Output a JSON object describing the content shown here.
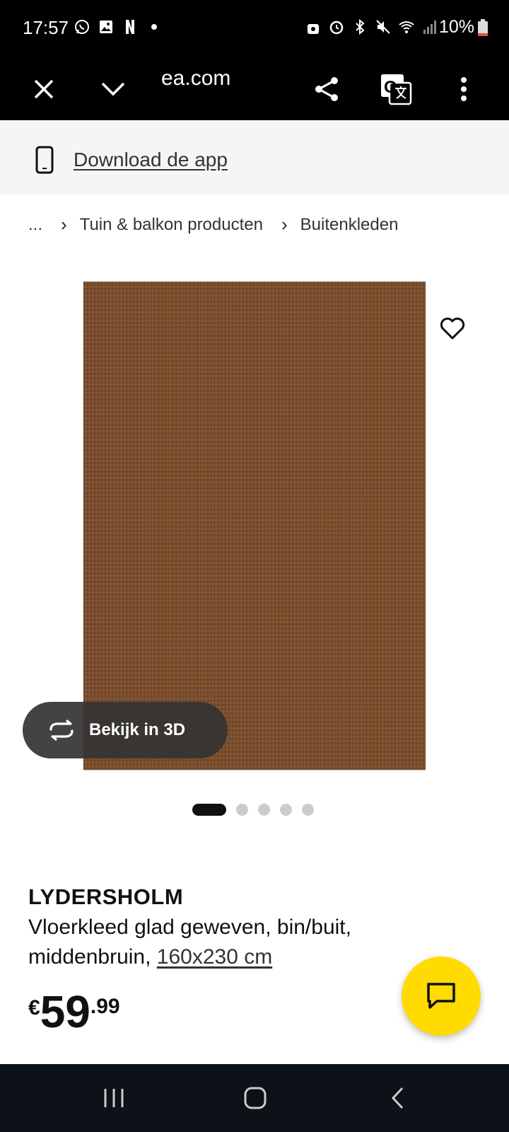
{
  "status_bar": {
    "time": "17:57",
    "battery": "10%",
    "left_icons": [
      "whatsapp-icon",
      "gallery-icon",
      "netflix-icon",
      "dot-icon"
    ],
    "right_icons": [
      "lock-icon",
      "alarm-icon",
      "bluetooth-icon",
      "mute-icon",
      "wifi-icon",
      "signal-icon"
    ]
  },
  "browser": {
    "url": "ea.com",
    "buttons": [
      "close-icon",
      "chevron-down-icon",
      "share-icon",
      "translate-icon",
      "more-icon"
    ]
  },
  "banner": {
    "link_label": "Download de app",
    "icon": "phone-icon"
  },
  "breadcrumb": {
    "ellipsis": "...",
    "items": [
      "Tuin & balkon producten",
      "Buitenkleden"
    ]
  },
  "gallery": {
    "view3d_label": "Bekijk in 3D",
    "image_count": 5,
    "active_index": 0
  },
  "product": {
    "name": "LYDERSHOLM",
    "description": "Vloerkleed glad geweven, bin/buit, middenbruin,",
    "size": "160x230 cm",
    "price_currency": "€",
    "price_int": "59",
    "price_dec": ".99"
  },
  "colors": {
    "accent_yellow": "#ffdb00",
    "rug_brown": "#7a4b28"
  },
  "nav": {
    "buttons": [
      "recents-icon",
      "home-icon",
      "back-icon"
    ]
  }
}
